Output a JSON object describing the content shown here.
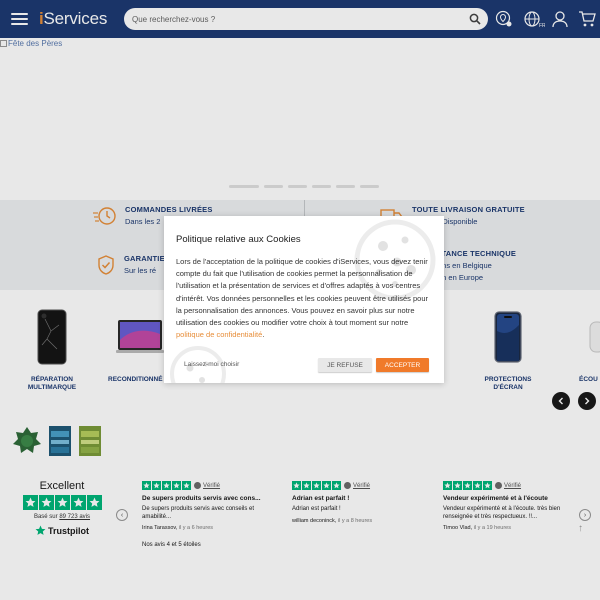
{
  "header": {
    "logo_prefix": "i",
    "logo_text": "Services",
    "search_placeholder": "Que recherchez-vous ?"
  },
  "hero": {
    "alt_text": "Fête des Pères",
    "dots_count": 6
  },
  "features": [
    {
      "icon": "fast-delivery-icon",
      "title": "COMMANDES LIVRÉES",
      "subtitle": "Dans les 2"
    },
    {
      "icon": "delivery-truck-icon",
      "title": "TOUTE LIVRAISON GRATUITE",
      "subtitle": "Magasin Disponible"
    },
    {
      "icon": "shield-check-icon",
      "title": "GARANTIE",
      "subtitle": "Sur les ré"
    },
    {
      "icon": "headset-icon",
      "title": "ASSISTANCE TECHNIQUE",
      "subtitle": "magasins en Belgique"
    },
    {
      "icon": "headset-icon",
      "title": "",
      "subtitle": "magasin en Europe"
    }
  ],
  "categories": [
    {
      "label_line1": "RÉPARATION",
      "label_line2": "MULTIMARQUE"
    },
    {
      "label_line1": "RECONDITIONNÉ",
      "label_line2": ""
    },
    {
      "label_line1": "PROTECTIONS",
      "label_line2": "D'ÉCRAN"
    },
    {
      "label_line1": "ÉCOU",
      "label_line2": ""
    }
  ],
  "trustpilot": {
    "rating_label": "Excellent",
    "based_on_prefix": "Basé sur",
    "review_count": "89 723 avis",
    "brand": "Trustpilot",
    "footer": "Nos avis 4 et 5 étoiles",
    "reviews": [
      {
        "verified": "Vérifié",
        "title": "De supers produits servis avec cons...",
        "body": "De supers produits servis avec conseils et amabilité...",
        "author": "Irina Tarassov,",
        "time": "il y a 6 heures"
      },
      {
        "verified": "Vérifié",
        "title": "Adrian est parfait !",
        "body": "Adrian est parfait !",
        "author": "william deconinck,",
        "time": "il y a 8 heures"
      },
      {
        "verified": "Vérifié",
        "title": "Vendeur expérimenté et à l'écoute",
        "body": "Vendeur expérimenté et à l'écoute. très bien renseignée et très respectueux. !!...",
        "author": "Timoo Vlad,",
        "time": "il y a 19 heures"
      }
    ]
  },
  "cookie_modal": {
    "title": "Politique relative aux Cookies",
    "text": "Lors de l'acceptation de la politique de cookies d'iServices, vous devez tenir compte du fait que l'utilisation de cookies permet la personnalisation de l'utilisation et la présentation de services et d'offres adaptés à vos centres d'intérêt. Vos données personnelles et les cookies peuvent être utilisés pour la personnalisation des annonces. Vous pouvez en savoir plus sur notre utilisation des cookies ou modifier votre choix à tout moment sur notre ",
    "link_text": "politique de confidentialité",
    "text_end": ".",
    "let_me_choose": "Laissez-moi choisir",
    "refuse_label": "JE REFUSE",
    "accept_label": "ACCEPTER"
  },
  "colors": {
    "header_bg": "#1d3a73",
    "accent": "#e78e3a",
    "accept_button": "#f07a2a",
    "trustpilot_green": "#00b67a"
  }
}
